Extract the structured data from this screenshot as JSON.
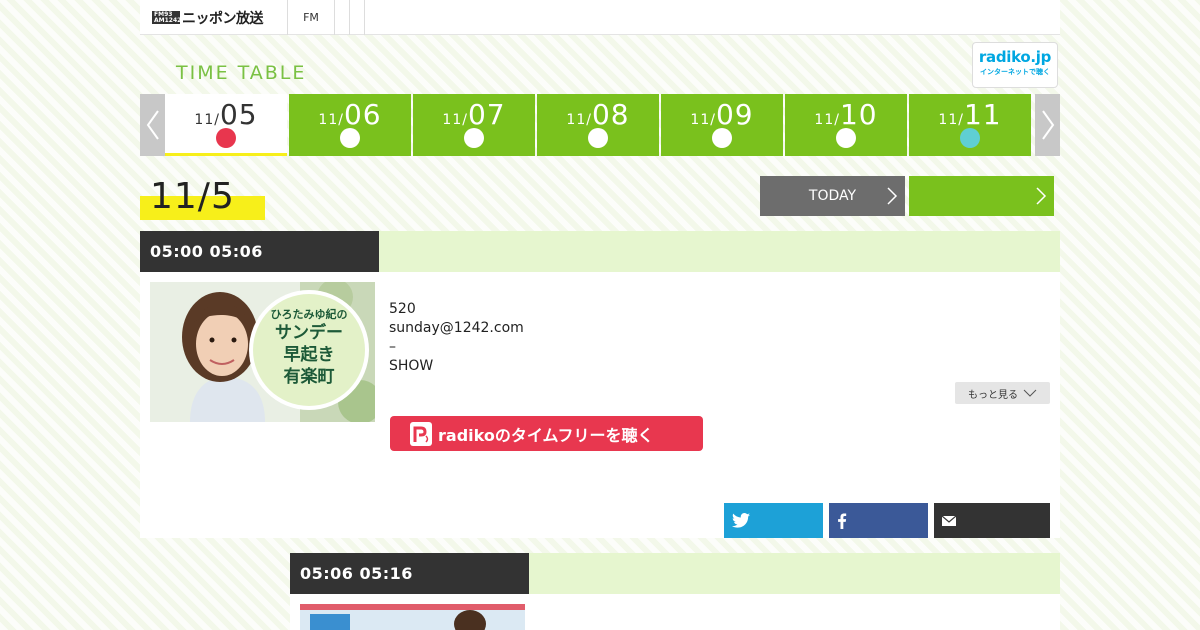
{
  "header": {
    "logo_badge": "FM93 AM1242",
    "logo_text": "ニッポン放送",
    "nav": [
      "FM",
      "",
      ""
    ]
  },
  "radiko_badge": {
    "logo": "radiko.jp",
    "sub": "インターネットで聴く"
  },
  "timetable": {
    "title": "TIME TABLE",
    "days": [
      {
        "month": "11/",
        "day": "05",
        "state": "active"
      },
      {
        "month": "11/",
        "day": "06",
        "state": ""
      },
      {
        "month": "11/",
        "day": "07",
        "state": ""
      },
      {
        "month": "11/",
        "day": "08",
        "state": ""
      },
      {
        "month": "11/",
        "day": "09",
        "state": ""
      },
      {
        "month": "11/",
        "day": "10",
        "state": ""
      },
      {
        "month": "11/",
        "day": "11",
        "state": "blue"
      }
    ],
    "current_date": "11/5",
    "today_label": "TODAY",
    "next_label": ""
  },
  "programs": [
    {
      "time": "05:00  05:06",
      "thumb_title_lines": [
        "ひろたみゆ紀の",
        "サンデー",
        "早起き",
        "有楽町"
      ],
      "desc_lines": [
        "520",
        "sunday@1242.com",
        "–",
        "SHOW"
      ],
      "more_label": "もっと見る",
      "radiko_label": "radikoのタイムフリーを聴く"
    },
    {
      "time": "05:06  05:16"
    }
  ],
  "colors": {
    "green": "#7ac11d",
    "active_dot": "#e8364e",
    "future_dot": "#5fcfd3",
    "twitter": "#1da1d7",
    "facebook": "#3b5998",
    "mail": "#333333",
    "radiko_pink": "#e8374f"
  },
  "icons": [
    "twitter-icon",
    "facebook-icon",
    "mail-icon",
    "chevron-left-icon",
    "chevron-right-icon",
    "chevron-down-icon"
  ]
}
